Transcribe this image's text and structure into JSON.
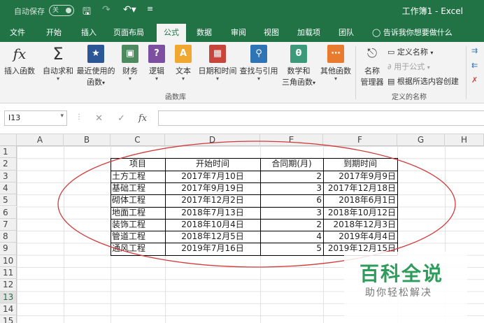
{
  "titlebar": {
    "autosave_label": "自动保存",
    "autosave_state": "关",
    "title": "工作簿1 - Excel"
  },
  "tabs": [
    "文件",
    "开始",
    "插入",
    "页面布局",
    "公式",
    "数据",
    "审阅",
    "视图",
    "加载项",
    "团队"
  ],
  "active_tab": "公式",
  "tell_me": "告诉我你想要做什么",
  "ribbon": {
    "function_library": {
      "insert_function": "插入函数",
      "autosum": "自动求和",
      "recent": [
        "最近使用的",
        "函数"
      ],
      "financial": "财务",
      "logical": "逻辑",
      "text": "文本",
      "datetime": "日期和时间",
      "lookup": "查找与引用",
      "math": [
        "数学和",
        "三角函数"
      ],
      "more": "其他函数",
      "group_label": "函数库"
    },
    "defined_names": {
      "name_manager": [
        "名称",
        "管理器"
      ],
      "define_name": "定义名称",
      "use_in_formula": "用于公式",
      "create_from_selection": "根据所选内容创建",
      "group_label": "定义的名称"
    }
  },
  "formula_bar": {
    "name_box": "I13",
    "formula": ""
  },
  "columns": [
    "A",
    "B",
    "C",
    "D",
    "E",
    "F",
    "G",
    "H"
  ],
  "rows": [
    "1",
    "2",
    "3",
    "4",
    "5",
    "6",
    "7",
    "8",
    "9",
    "10",
    "11",
    "12",
    "13",
    "14",
    "15"
  ],
  "selected_row": "13",
  "table": {
    "headers": [
      "项目",
      "开始时间",
      "合同期(月)",
      "到期时间"
    ],
    "rows": [
      [
        "土方工程",
        "2017年7月10日",
        "2",
        "2017年9月9日"
      ],
      [
        "基础工程",
        "2017年9月19日",
        "3",
        "2017年12月18日"
      ],
      [
        "砌体工程",
        "2017年12月2日",
        "6",
        "2018年6月1日"
      ],
      [
        "地面工程",
        "2018年7月13日",
        "3",
        "2018年10月12日"
      ],
      [
        "装饰工程",
        "2018年10月4日",
        "2",
        "2018年12月3日"
      ],
      [
        "管道工程",
        "2018年12月5日",
        "4",
        "2019年4月4日"
      ],
      [
        "通风工程",
        "2019年7月16日",
        "5",
        "2019年12月15日"
      ]
    ]
  },
  "watermark": {
    "big": "百科全说",
    "small": "助你轻松解决"
  },
  "colors": {
    "excel_green": "#217346",
    "annotation_red": "#d23a3a"
  }
}
